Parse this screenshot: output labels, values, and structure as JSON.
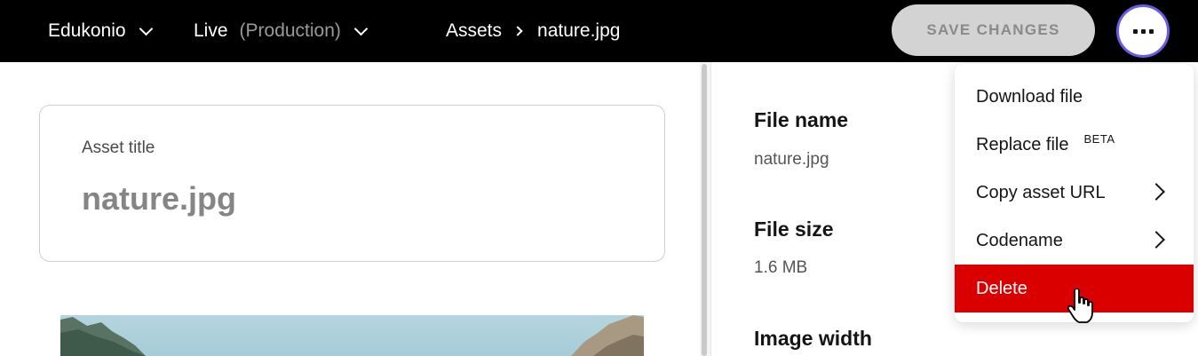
{
  "topbar": {
    "project": "Edukonio",
    "environment": "Live",
    "environment_note": "(Production)",
    "breadcrumb": [
      "Assets",
      "nature.jpg"
    ],
    "save_label": "SAVE CHANGES",
    "more_icon": "ellipsis-icon"
  },
  "asset": {
    "title_label": "Asset title",
    "title_value": "nature.jpg"
  },
  "details": {
    "file_name_label": "File name",
    "file_name_value": "nature.jpg",
    "file_size_label": "File size",
    "file_size_value": "1.6 MB",
    "image_width_label": "Image width"
  },
  "menu": {
    "items": [
      {
        "label": "Download file"
      },
      {
        "label": "Replace file",
        "badge": "BETA"
      },
      {
        "label": "Copy asset URL",
        "submenu": true
      },
      {
        "label": "Codename",
        "submenu": true
      },
      {
        "label": "Delete",
        "danger": true
      }
    ]
  },
  "colors": {
    "topbar": "#000000",
    "accent": "#6b5ce7",
    "danger": "#db0000",
    "disabled_button": "#d3d3d3"
  }
}
